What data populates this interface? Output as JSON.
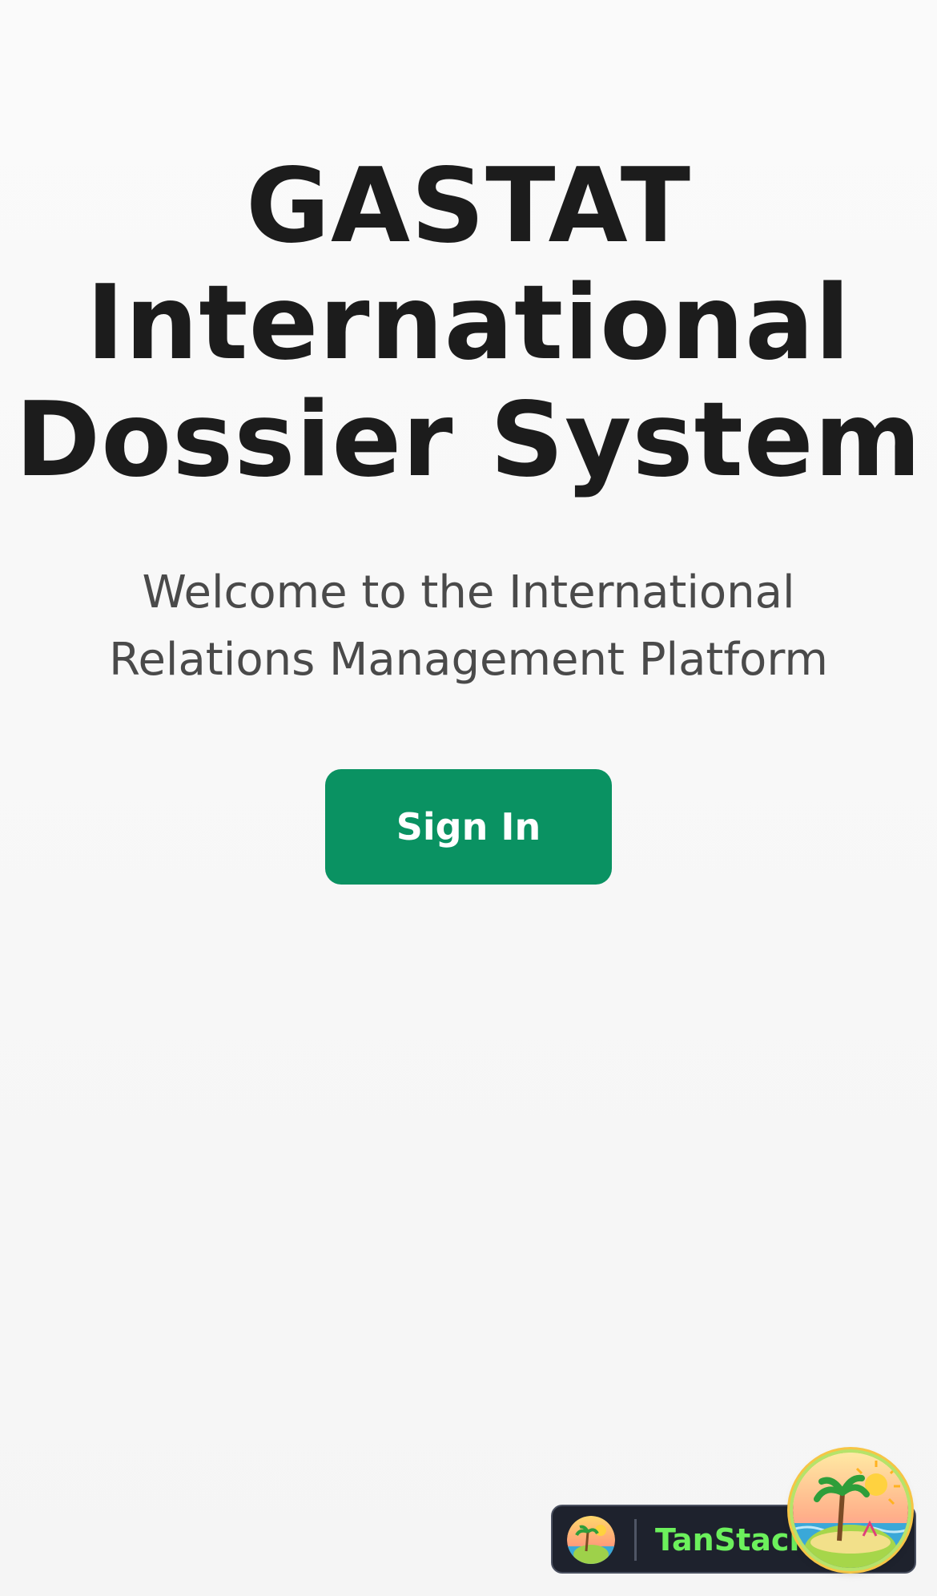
{
  "hero": {
    "title_lines": [
      "GASTAT",
      "International",
      "Dossier System"
    ],
    "subtitle_lines": [
      "Welcome to the International",
      "Relations Management Platform"
    ]
  },
  "actions": {
    "sign_in_label": "Sign In"
  },
  "devtools": {
    "brand_label": "TanStack R",
    "logo_icon": "tanstack-island-logo-icon"
  },
  "colors": {
    "primary": "#0a9262",
    "title": "#1c1c1c",
    "subtitle": "#4a4a4a",
    "devtools_bg": "#1e222d",
    "devtools_brand": "#6cf05c"
  }
}
